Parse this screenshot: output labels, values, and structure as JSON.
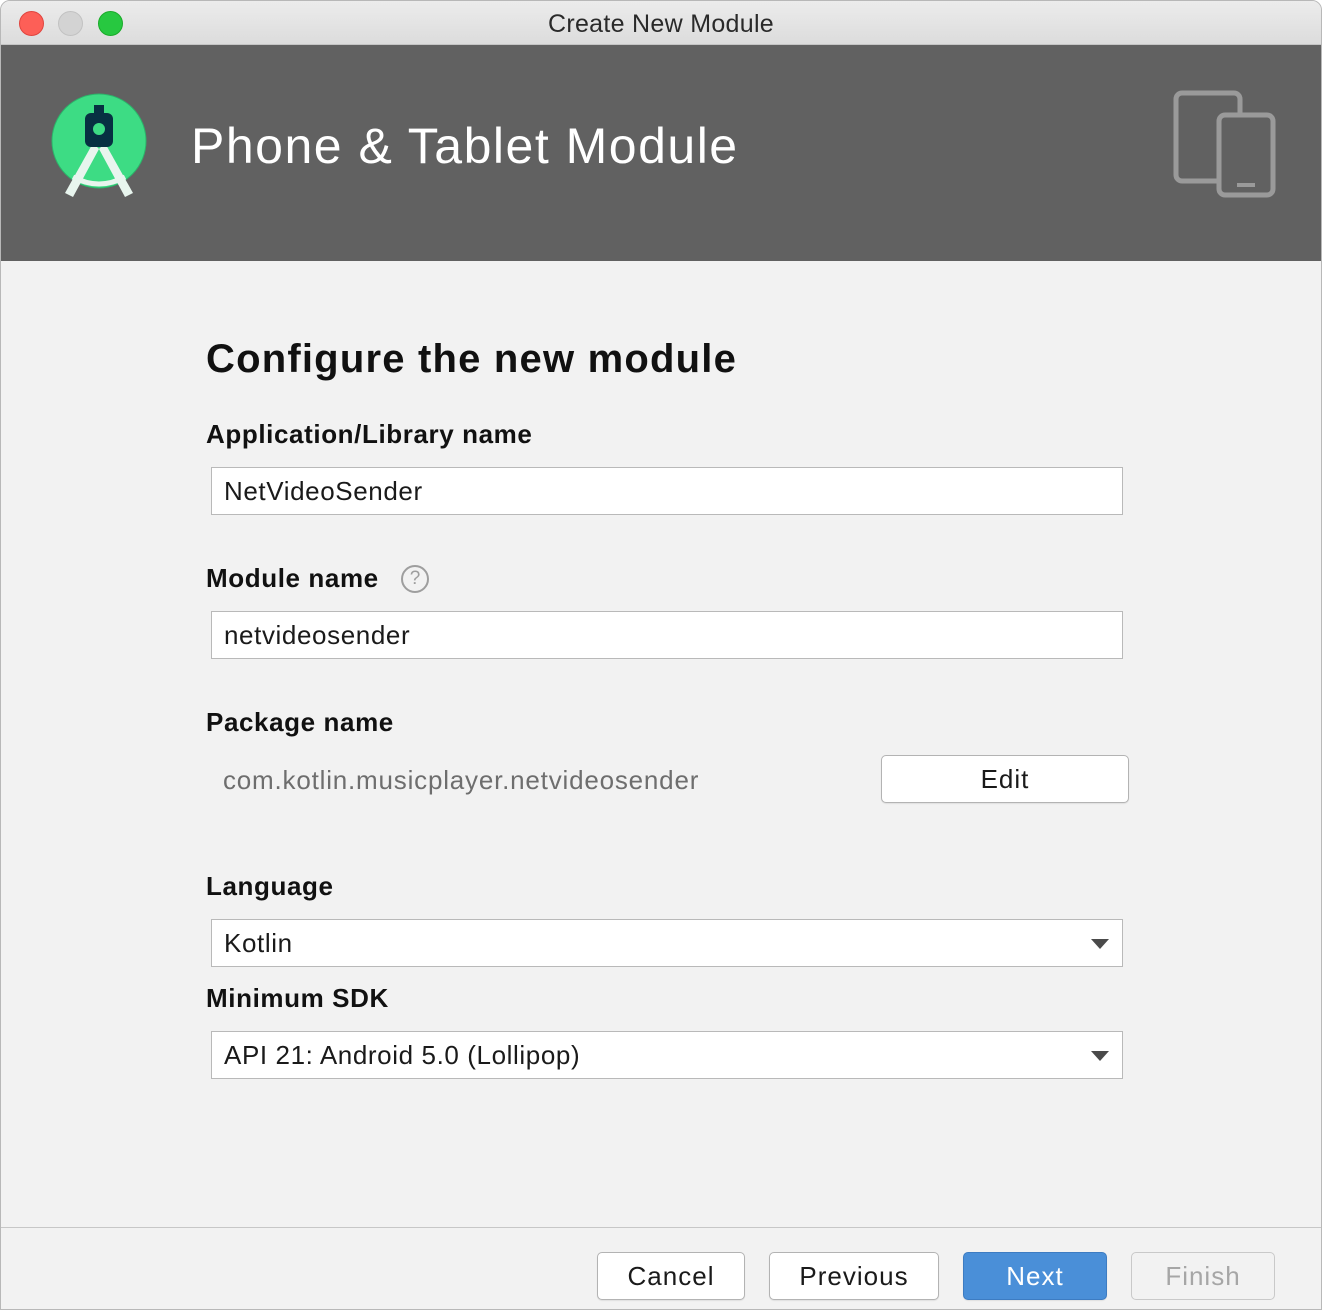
{
  "window": {
    "title": "Create New Module"
  },
  "header": {
    "title": "Phone & Tablet Module",
    "logo_icon": "android-studio-logo-icon",
    "device_icon": "phone-tablet-icon"
  },
  "form": {
    "section_title": "Configure the new module",
    "app_name": {
      "label": "Application/Library name",
      "value": "NetVideoSender"
    },
    "module_name": {
      "label": "Module name",
      "help": "?",
      "value": "netvideosender"
    },
    "package_name": {
      "label": "Package name",
      "value": "com.kotlin.musicplayer.netvideosender",
      "edit_label": "Edit"
    },
    "language": {
      "label": "Language",
      "selected": "Kotlin"
    },
    "min_sdk": {
      "label": "Minimum SDK",
      "selected": "API 21: Android 5.0 (Lollipop)"
    }
  },
  "footer": {
    "cancel_label": "Cancel",
    "previous_label": "Previous",
    "next_label": "Next",
    "finish_label": "Finish"
  },
  "colors": {
    "header_bg": "#616161",
    "primary_button": "#4a8fd8",
    "android_green": "#3ddc84"
  }
}
